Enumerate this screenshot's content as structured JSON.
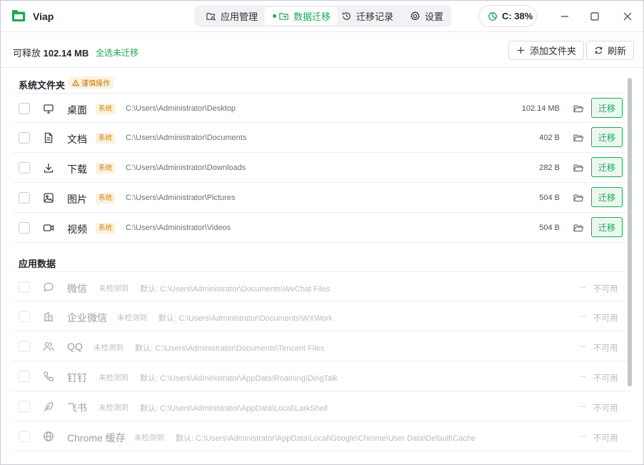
{
  "app": {
    "name": "Viap",
    "brand_color": "#1aaa55"
  },
  "nav": {
    "tabs": [
      {
        "label": "应用管理",
        "icon": "app-manage-icon",
        "active": false
      },
      {
        "label": "数据迁移",
        "icon": "folder-migrate-icon",
        "active": true
      },
      {
        "label": "迁移记录",
        "icon": "history-icon",
        "active": false
      },
      {
        "label": "设置",
        "icon": "gear-icon",
        "active": false
      }
    ]
  },
  "disk": {
    "label": "C: 38%",
    "usage_fraction": 0.38
  },
  "toolbar": {
    "releasable_label": "可释放",
    "releasable_value": "102.14 MB",
    "select_all": "全选未迁移",
    "add_folder": "添加文件夹",
    "refresh": "刷新"
  },
  "system_section": {
    "title": "系统文件夹",
    "warning": "谨慎操作",
    "tag": "系统",
    "folder_icon": "folder-open-icon",
    "action": "迁移",
    "items": [
      {
        "name": "桌面",
        "icon": "monitor-icon",
        "path": "C:\\Users\\Administrator\\Desktop",
        "size": "102.14 MB"
      },
      {
        "name": "文档",
        "icon": "document-icon",
        "path": "C:\\Users\\Administrator\\Documents",
        "size": "402 B"
      },
      {
        "name": "下载",
        "icon": "download-icon",
        "path": "C:\\Users\\Administrator\\Downloads",
        "size": "282 B"
      },
      {
        "name": "图片",
        "icon": "image-icon",
        "path": "C:\\Users\\Administrator\\Pictures",
        "size": "504 B"
      },
      {
        "name": "视频",
        "icon": "video-icon",
        "path": "C:\\Users\\Administrator\\Videos",
        "size": "504 B"
      }
    ]
  },
  "app_section": {
    "title": "应用数据",
    "status": "未检测到",
    "unavailable": "不可用",
    "items": [
      {
        "name": "微信",
        "icon": "chat-bubble-icon",
        "path": "默认: C:\\Users\\Administrator\\Documents\\WeChat Files",
        "size": "--"
      },
      {
        "name": "企业微信",
        "icon": "building-icon",
        "path": "默认: C:\\Users\\Administrator\\Documents\\WXWork",
        "size": "--"
      },
      {
        "name": "QQ",
        "icon": "users-icon",
        "path": "默认: C:\\Users\\Administrator\\Documents\\Tencent Files",
        "size": "--"
      },
      {
        "name": "钉钉",
        "icon": "phone-icon",
        "path": "默认: C:\\Users\\Administrator\\AppData\\Roaming\\DingTalk",
        "size": "--"
      },
      {
        "name": "飞书",
        "icon": "feather-icon",
        "path": "默认: C:\\Users\\Administrator\\AppData\\Local\\LarkShell",
        "size": "--"
      },
      {
        "name": "Chrome 缓存",
        "icon": "globe-icon",
        "path": "默认: C:\\Users\\Administrator\\AppData\\Local\\Google\\Chrome\\User Data\\Default\\Cache",
        "size": "--"
      }
    ]
  }
}
